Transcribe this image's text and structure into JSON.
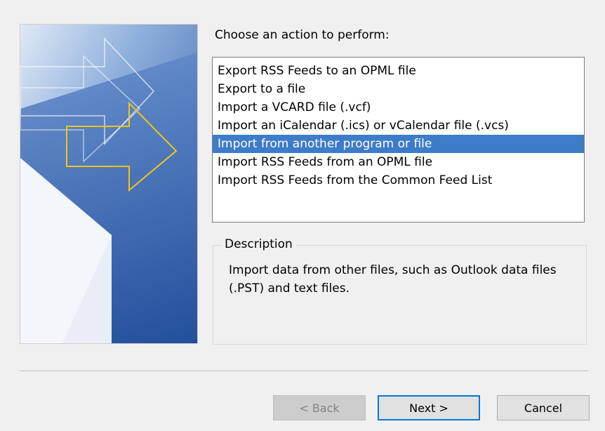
{
  "prompt": "Choose an action to perform:",
  "actions": [
    {
      "label": "Export RSS Feeds to an OPML file",
      "selected": false
    },
    {
      "label": "Export to a file",
      "selected": false
    },
    {
      "label": "Import a VCARD file (.vcf)",
      "selected": false
    },
    {
      "label": "Import an iCalendar (.ics) or vCalendar file (.vcs)",
      "selected": false
    },
    {
      "label": "Import from another program or file",
      "selected": true
    },
    {
      "label": "Import RSS Feeds from an OPML file",
      "selected": false
    },
    {
      "label": "Import RSS Feeds from the Common Feed List",
      "selected": false
    }
  ],
  "description": {
    "legend": "Description",
    "text": "Import data from other files, such as Outlook data files (.PST) and text files."
  },
  "buttons": {
    "back": "< Back",
    "next": "Next >",
    "cancel": "Cancel"
  },
  "colors": {
    "selection": "#3e7bc9",
    "accent_arrow": "#f0c419",
    "focus_border": "#0078d7"
  }
}
